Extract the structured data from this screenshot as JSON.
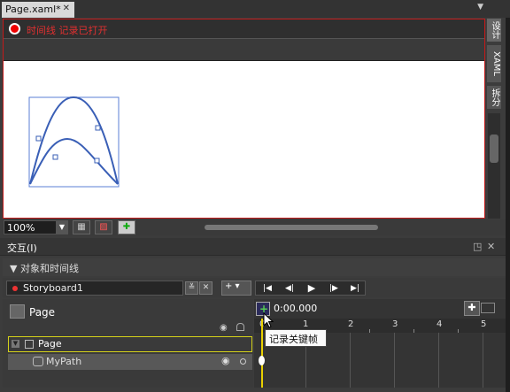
{
  "document_tab": {
    "title": "Page.xaml*",
    "close": "✕",
    "menu_glyph": "▼"
  },
  "recording": {
    "text": "时间线 记录已打开"
  },
  "view_tabs": [
    {
      "label": "设计"
    },
    {
      "label": "XAML"
    },
    {
      "label": "拆分"
    }
  ],
  "zoom": {
    "value": "100%"
  },
  "panel": {
    "title": "交互(I)",
    "pin": "◳",
    "close": "✕"
  },
  "objects_timeline": {
    "title": "▼ 对象和时间线"
  },
  "storyboard": {
    "name": "Storyboard1",
    "plus_label": "+ ▾"
  },
  "tree": {
    "root_label": "Page",
    "item_page": "Page",
    "item_path": "MyPath"
  },
  "timeline": {
    "time": "0:00.000",
    "ticks": [
      "0",
      "1",
      "2",
      "3",
      "4",
      "5"
    ]
  },
  "tooltip": {
    "text": "记录关键帧"
  },
  "colors": {
    "recording": "#e00000",
    "selection": "#d4d11a",
    "accent": "#5577cc"
  }
}
